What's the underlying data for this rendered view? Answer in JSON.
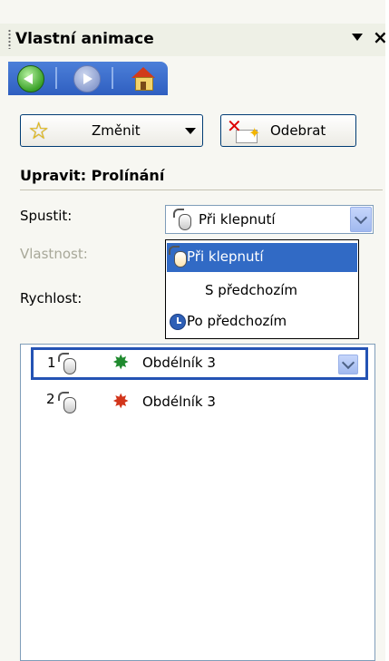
{
  "pane": {
    "title": "Vlastní animace",
    "icons": {
      "menu": "chevron-down-icon",
      "close": "close-icon"
    }
  },
  "nav": {
    "back": "back-arrow-icon",
    "forward": "forward-arrow-icon",
    "home": "home-icon"
  },
  "toolbar": {
    "change_label": "Změnit",
    "remove_label": "Odebrat"
  },
  "section": {
    "heading": "Upravit: Prolínání",
    "start_label": "Spustit:",
    "property_label": "Vlastnost:",
    "speed_label": "Rychlost:"
  },
  "start_combo": {
    "value": "Při klepnutí",
    "options": [
      "Při klepnutí",
      "S předchozím",
      "Po předchozím"
    ]
  },
  "animation_list": {
    "items": [
      {
        "index": "1",
        "name": "Obdélník 3",
        "trigger": "mouse-icon",
        "effect": "green-star-icon"
      },
      {
        "index": "2",
        "name": "Obdélník 3",
        "trigger": "mouse-icon",
        "effect": "red-star-icon"
      }
    ]
  },
  "colors": {
    "selection": "#316ac5",
    "border": "#7f9db9",
    "nav_blue": "#2f5fc0"
  }
}
